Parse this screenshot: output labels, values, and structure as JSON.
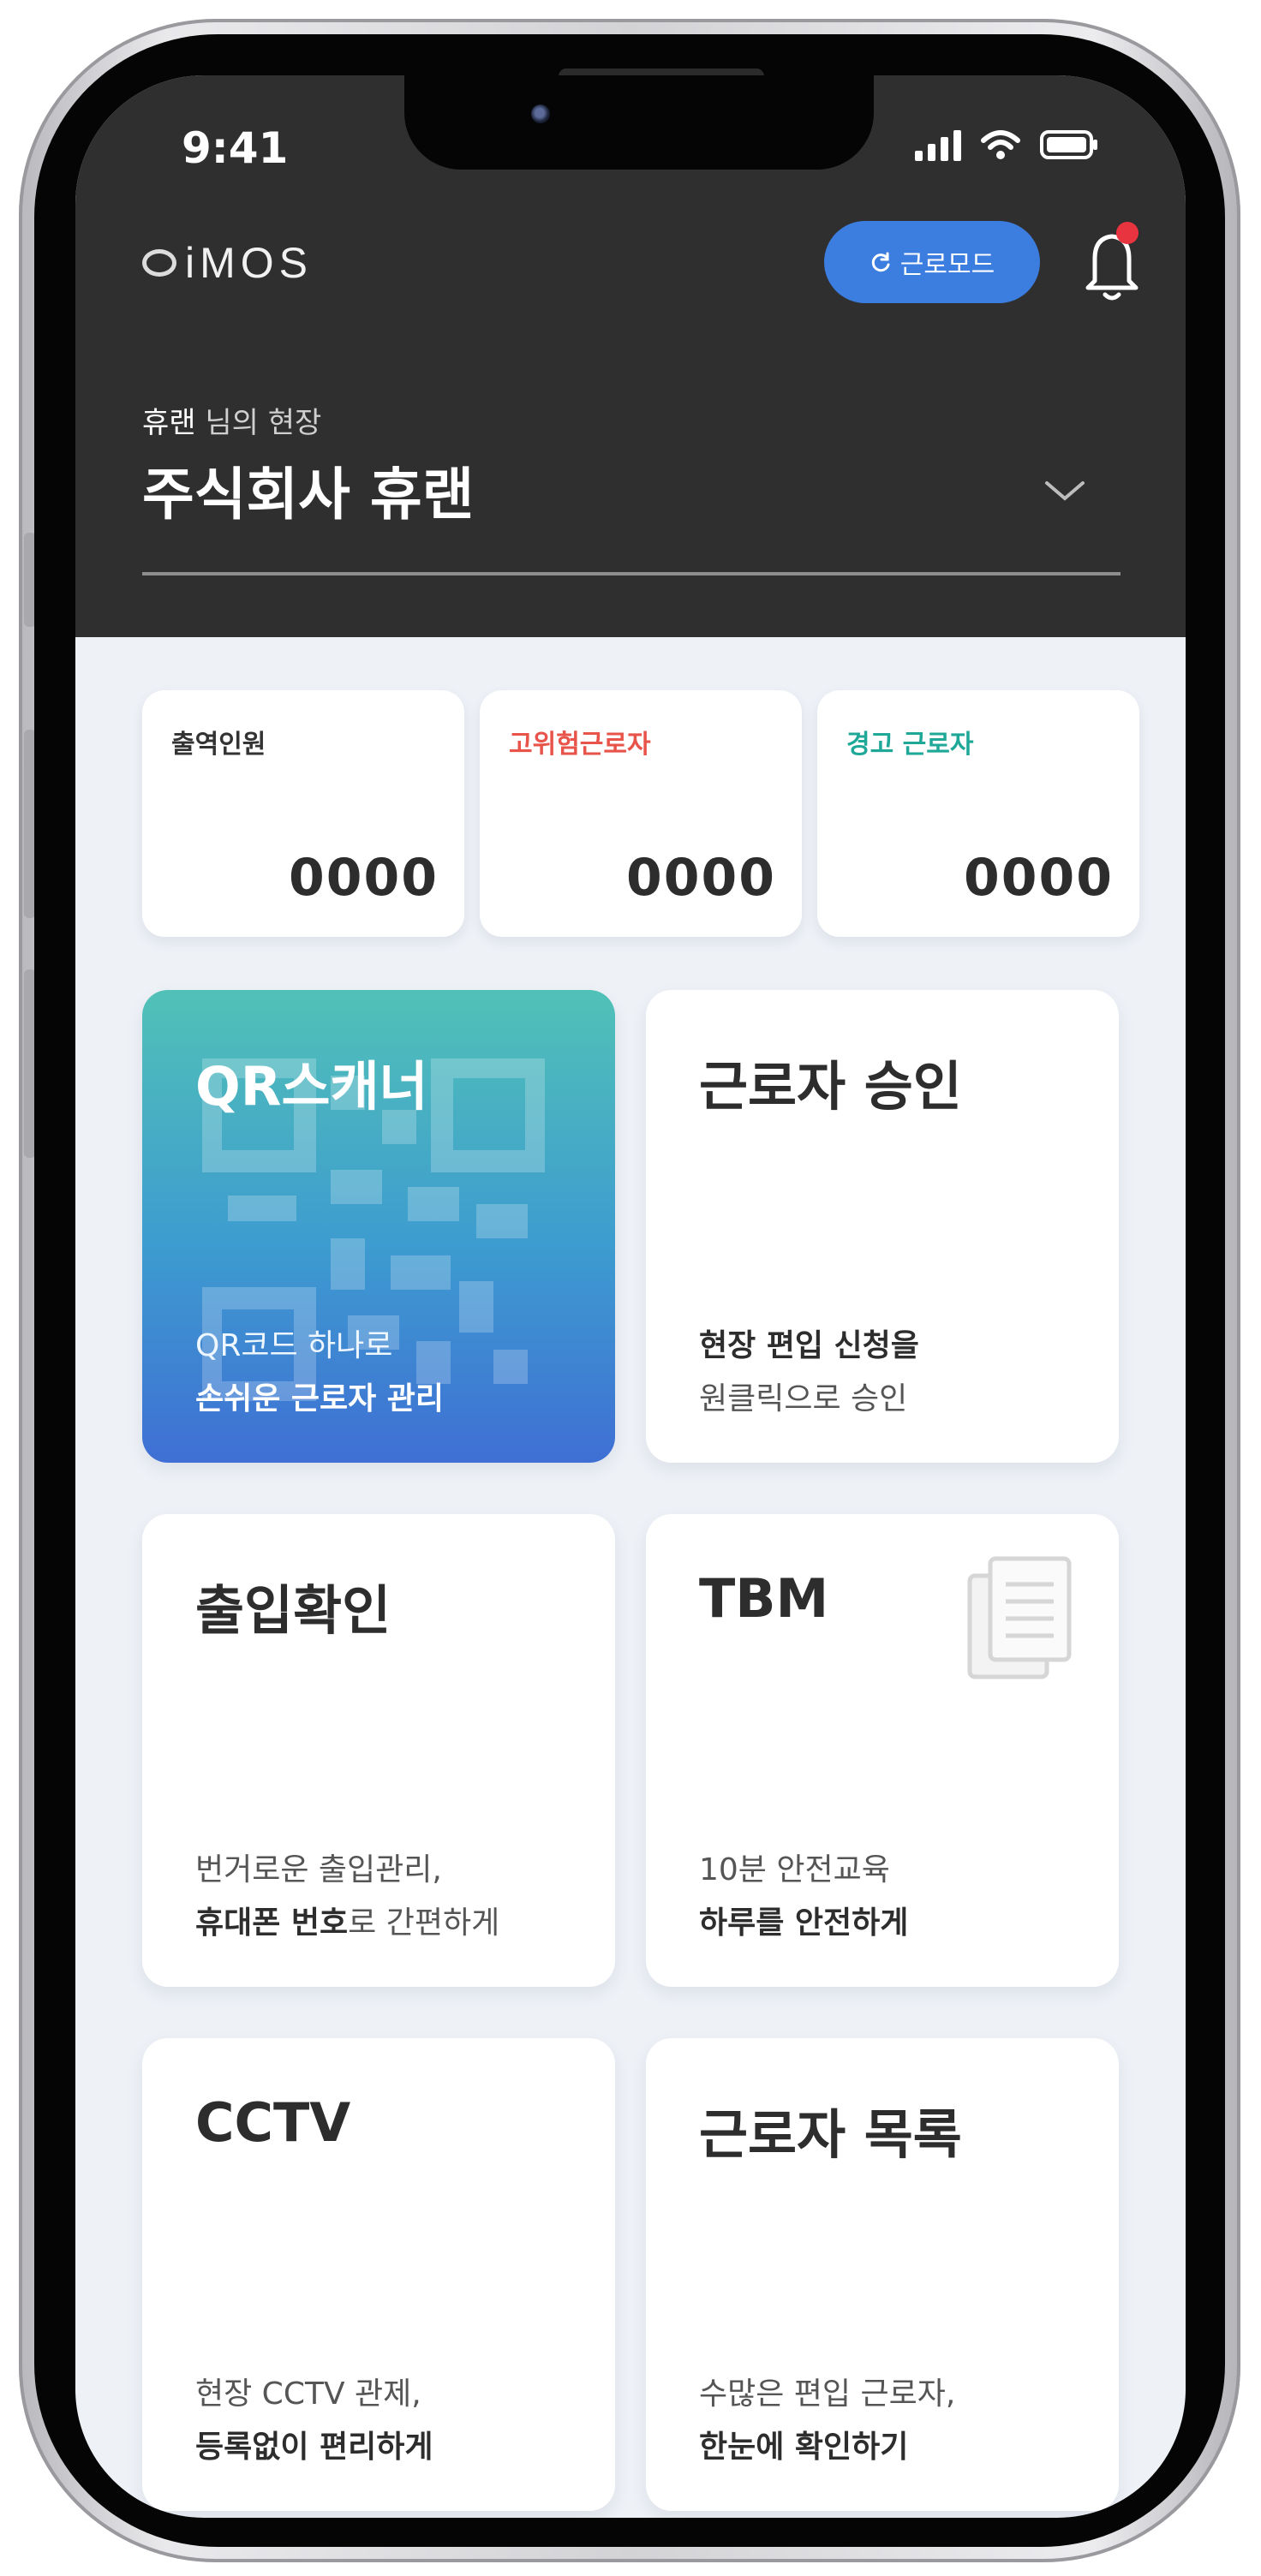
{
  "status_bar": {
    "time": "9:41"
  },
  "header": {
    "logo": "iMOS",
    "mode_button": "근로모드",
    "site_label_name": "휴랜",
    "site_label_suffix": " 님의 현장",
    "site_name": "주식회사 휴랜"
  },
  "stats": [
    {
      "label": "출역인원",
      "value": "0000",
      "label_color": "#333333"
    },
    {
      "label": "고위험근로자",
      "value": "0000",
      "label_color": "#e8534a"
    },
    {
      "label": "경고 근로자",
      "value": "0000",
      "label_color": "#1fa898"
    }
  ],
  "tiles": {
    "qr": {
      "title": "QR스캐너",
      "line1": "QR코드 하나로",
      "line2_bold": "손쉬운 근로자 관리"
    },
    "approve": {
      "title": "근로자 승인",
      "line1_bold": "현장 편입 신청을",
      "line2": "원클릭으로 승인"
    },
    "access": {
      "title": "출입확인",
      "line1": "번거로운 출입관리,",
      "line2_bold": "휴대폰 번호",
      "line2_rest": "로 간편하게"
    },
    "tbm": {
      "title": "TBM",
      "line1": "10분 안전교육",
      "line2_bold": "하루를 안전하게"
    },
    "cctv": {
      "title": "CCTV",
      "line1": "현장 CCTV 관제,",
      "line2_bold": "등록없이 편리하게"
    },
    "list": {
      "title": "근로자 목록",
      "line1": "수많은 편입 근로자,",
      "line2_bold": "한눈에 확인하기"
    }
  },
  "colors": {
    "header_bg": "#2f2f2f",
    "accent_blue": "#3c7de0",
    "notification_dot": "#e8343f",
    "screen_bg": "#eef1f6"
  },
  "icons": [
    "wifi-icon",
    "battery-icon",
    "cellular-icon",
    "refresh-icon",
    "bell-icon",
    "chevron-down-icon",
    "document-icon",
    "qr-code-icon"
  ]
}
